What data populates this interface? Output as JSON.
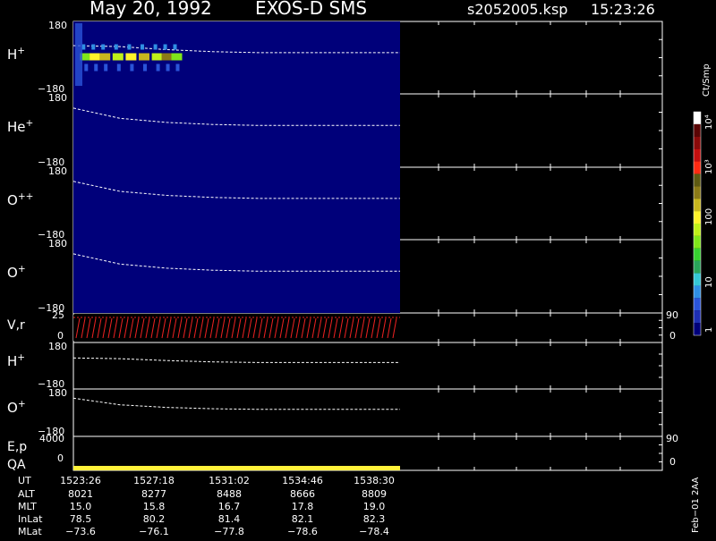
{
  "header": {
    "date": "May 20, 1992",
    "instrument": "EXOS-D SMS",
    "file": "s2052005.ksp",
    "time": "15:23:26"
  },
  "colorbar": {
    "unit": "Ct/Smp",
    "labels": [
      "1",
      "10",
      "100",
      "10³",
      "10⁴"
    ],
    "colors": [
      "#00007a",
      "#1e2fb4",
      "#2a54d8",
      "#2f8fe4",
      "#35c7d6",
      "#29a35a",
      "#37d130",
      "#7fe61a",
      "#bff019",
      "#fff22a",
      "#c8b61e",
      "#8b7a17",
      "#5e5a12",
      "#ff2a12",
      "#c30f0f",
      "#8a0a0a",
      "#5a0505",
      "#ffffff"
    ]
  },
  "panels": [
    {
      "label": "H",
      "sup": "+",
      "top": "180",
      "bottom": "−180"
    },
    {
      "label": "He",
      "sup": "+",
      "top": "180",
      "bottom": "−180"
    },
    {
      "label": "O",
      "sup": "++",
      "top": "180",
      "bottom": "−180"
    },
    {
      "label": "O",
      "sup": "+",
      "top": "180",
      "bottom": "−180"
    }
  ],
  "vr_panel": {
    "label": "V,r",
    "left_top": "25",
    "left_bottom": "0",
    "right_top": "90",
    "right_bottom": "0"
  },
  "lower_panels": [
    {
      "label": "H",
      "sup": "+",
      "top": "180",
      "bottom": "−180"
    },
    {
      "label": "O",
      "sup": "+",
      "top": "180",
      "bottom": "−180"
    }
  ],
  "ep_panel": {
    "label1": "E,p",
    "label2": "QA",
    "left_top": "4000",
    "left_bottom": "0",
    "right_top": "90",
    "right_bottom": "0"
  },
  "ephemeris": {
    "row_labels": [
      "UT",
      "ALT",
      "MLT",
      "InLat",
      "MLat"
    ],
    "columns": [
      [
        "1523:26",
        "8021",
        "15.0",
        "78.5",
        "−73.6"
      ],
      [
        "1527:18",
        "8277",
        "15.8",
        "80.2",
        "−76.1"
      ],
      [
        "1531:02",
        "8488",
        "16.7",
        "81.4",
        "−77.8"
      ],
      [
        "1534:46",
        "8666",
        "17.8",
        "82.1",
        "−78.6"
      ],
      [
        "1538:30",
        "8809",
        "19.0",
        "82.3",
        "−78.4"
      ]
    ]
  },
  "footer_note": "Feb−01 2AA",
  "chart_data": {
    "type": "heatmap",
    "title": "May 20, 1992   EXOS-D SMS",
    "xlabel": "UT",
    "x_ticks": [
      "1523:26",
      "1527:18",
      "1531:02",
      "1534:46",
      "1538:30"
    ],
    "ylim": [
      -180,
      180
    ],
    "series": [
      {
        "name": "H+",
        "dashed_reference_y": [
          60,
          55,
          40,
          30,
          25,
          25,
          25,
          25
        ]
      },
      {
        "name": "He+",
        "dashed_reference_y": [
          110,
          60,
          40,
          30,
          25,
          25,
          25,
          25
        ]
      },
      {
        "name": "O++",
        "dashed_reference_y": [
          110,
          60,
          40,
          30,
          25,
          25,
          25,
          25
        ]
      },
      {
        "name": "O+",
        "dashed_reference_y": [
          110,
          60,
          40,
          30,
          25,
          25,
          25,
          25
        ]
      }
    ],
    "h_plus_band": [
      {
        "x": 0.02,
        "level": 7
      },
      {
        "x": 0.05,
        "level": 9
      },
      {
        "x": 0.08,
        "level": 10
      },
      {
        "x": 0.12,
        "level": 8
      },
      {
        "x": 0.16,
        "level": 9
      },
      {
        "x": 0.2,
        "level": 10
      },
      {
        "x": 0.24,
        "level": 8
      },
      {
        "x": 0.27,
        "level": 11
      },
      {
        "x": 0.3,
        "level": 7
      }
    ]
  }
}
